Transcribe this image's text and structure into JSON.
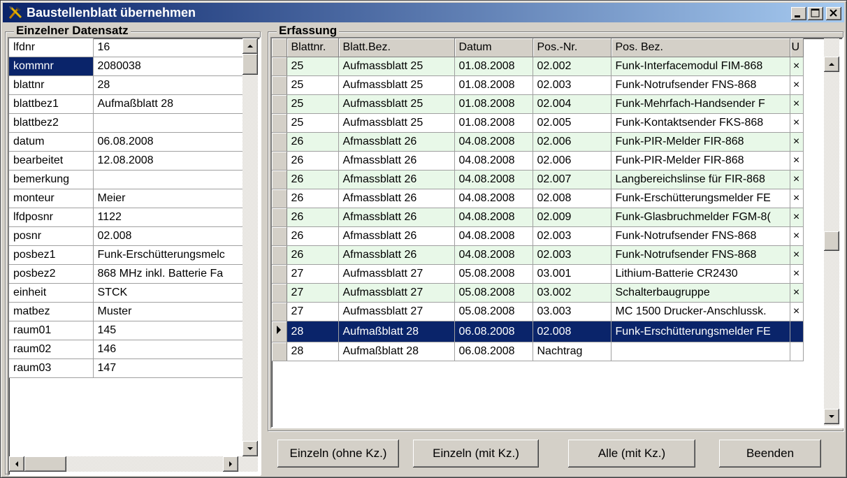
{
  "window": {
    "title": "Baustellenblatt übernehmen"
  },
  "left_group": {
    "label": "Einzelner Datensatz",
    "selected_key": "kommnr",
    "rows": [
      {
        "key": "lfdnr",
        "value": "16"
      },
      {
        "key": "kommnr",
        "value": "2080038"
      },
      {
        "key": "blattnr",
        "value": "28"
      },
      {
        "key": "blattbez1",
        "value": "Aufmaßblatt 28"
      },
      {
        "key": "blattbez2",
        "value": ""
      },
      {
        "key": "datum",
        "value": "06.08.2008"
      },
      {
        "key": "bearbeitet",
        "value": "12.08.2008"
      },
      {
        "key": "bemerkung",
        "value": ""
      },
      {
        "key": "monteur",
        "value": "Meier"
      },
      {
        "key": "lfdposnr",
        "value": "1122"
      },
      {
        "key": "posnr",
        "value": "02.008"
      },
      {
        "key": "posbez1",
        "value": "Funk-Erschütterungsmelc"
      },
      {
        "key": "posbez2",
        "value": "868 MHz inkl. Batterie Fa"
      },
      {
        "key": "einheit",
        "value": "STCK"
      },
      {
        "key": "matbez",
        "value": "Muster"
      },
      {
        "key": "raum01",
        "value": "145"
      },
      {
        "key": "raum02",
        "value": "146"
      },
      {
        "key": "raum03",
        "value": "147"
      }
    ]
  },
  "right_group": {
    "label": "Erfassung",
    "columns": [
      "Blattnr.",
      "Blatt.Bez.",
      "Datum",
      "Pos.-Nr.",
      "Pos. Bez.",
      "U"
    ],
    "rows": [
      {
        "blattnr": "25",
        "bez": "Aufmassblatt 25",
        "datum": "01.08.2008",
        "posnr": "02.002",
        "posbez": "Funk-Interfacemodul FIM-868",
        "u": "×",
        "style": "green"
      },
      {
        "blattnr": "25",
        "bez": "Aufmassblatt 25",
        "datum": "01.08.2008",
        "posnr": "02.003",
        "posbez": "Funk-Notrufsender FNS-868",
        "u": "×",
        "style": "white"
      },
      {
        "blattnr": "25",
        "bez": "Aufmassblatt 25",
        "datum": "01.08.2008",
        "posnr": "02.004",
        "posbez": "Funk-Mehrfach-Handsender F",
        "u": "×",
        "style": "green"
      },
      {
        "blattnr": "25",
        "bez": "Aufmassblatt 25",
        "datum": "01.08.2008",
        "posnr": "02.005",
        "posbez": "Funk-Kontaktsender FKS-868",
        "u": "×",
        "style": "white"
      },
      {
        "blattnr": "26",
        "bez": "Afmassblatt 26",
        "datum": "04.08.2008",
        "posnr": "02.006",
        "posbez": "Funk-PIR-Melder FIR-868",
        "u": "×",
        "style": "green"
      },
      {
        "blattnr": "26",
        "bez": "Afmassblatt 26",
        "datum": "04.08.2008",
        "posnr": "02.006",
        "posbez": "Funk-PIR-Melder FIR-868",
        "u": "×",
        "style": "white"
      },
      {
        "blattnr": "26",
        "bez": "Afmassblatt 26",
        "datum": "04.08.2008",
        "posnr": "02.007",
        "posbez": "Langbereichslinse für FIR-868",
        "u": "×",
        "style": "green"
      },
      {
        "blattnr": "26",
        "bez": "Afmassblatt 26",
        "datum": "04.08.2008",
        "posnr": "02.008",
        "posbez": "Funk-Erschütterungsmelder FE",
        "u": "×",
        "style": "white"
      },
      {
        "blattnr": "26",
        "bez": "Afmassblatt 26",
        "datum": "04.08.2008",
        "posnr": "02.009",
        "posbez": "Funk-Glasbruchmelder FGM-8(",
        "u": "×",
        "style": "green"
      },
      {
        "blattnr": "26",
        "bez": "Afmassblatt 26",
        "datum": "04.08.2008",
        "posnr": "02.003",
        "posbez": "Funk-Notrufsender FNS-868",
        "u": "×",
        "style": "white"
      },
      {
        "blattnr": "26",
        "bez": "Afmassblatt 26",
        "datum": "04.08.2008",
        "posnr": "02.003",
        "posbez": "Funk-Notrufsender FNS-868",
        "u": "×",
        "style": "green"
      },
      {
        "blattnr": "27",
        "bez": "Aufmassblatt 27",
        "datum": "05.08.2008",
        "posnr": "03.001",
        "posbez": "Lithium-Batterie CR2430",
        "u": "×",
        "style": "white"
      },
      {
        "blattnr": "27",
        "bez": "Aufmassblatt 27",
        "datum": "05.08.2008",
        "posnr": "03.002",
        "posbez": "Schalterbaugruppe",
        "u": "×",
        "style": "green"
      },
      {
        "blattnr": "27",
        "bez": "Aufmassblatt 27",
        "datum": "05.08.2008",
        "posnr": "03.003",
        "posbez": "MC 1500 Drucker-Anschlussk.",
        "u": "×",
        "style": "white"
      },
      {
        "blattnr": "28",
        "bez": "Aufmaßblatt 28",
        "datum": "06.08.2008",
        "posnr": "02.008",
        "posbez": "Funk-Erschütterungsmelder FE",
        "u": "",
        "style": "selected"
      },
      {
        "blattnr": "28",
        "bez": "Aufmaßblatt 28",
        "datum": "06.08.2008",
        "posnr": "Nachtrag",
        "posbez": "",
        "u": "",
        "style": "white"
      }
    ]
  },
  "buttons": {
    "einzeln_ohne": "Einzeln (ohne Kz.)",
    "einzeln_mit": "Einzeln (mit Kz.)",
    "alle_mit": "Alle (mit Kz.)",
    "beenden": "Beenden"
  },
  "colors": {
    "row_green": "#e8f8e8",
    "selection": "#0a246a",
    "face": "#d4d0c8"
  }
}
